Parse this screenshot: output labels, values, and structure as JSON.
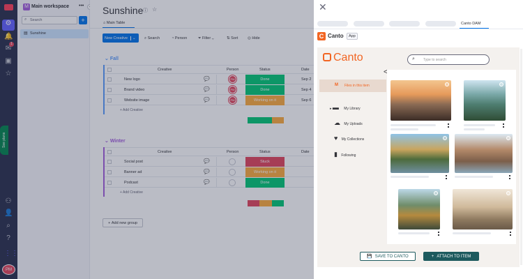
{
  "workspace": {
    "name": "Main workspace",
    "badge": "M",
    "search_placeholder": "Search",
    "boards": [
      "Sunshine"
    ]
  },
  "rail": {
    "notif_count": "1",
    "see_plans": "See plans",
    "avatar": "PM"
  },
  "board": {
    "title": "Sunshine",
    "view_tab": "Main Table",
    "toolbar": {
      "new": "New Creative",
      "search": "Search",
      "person": "Person",
      "filter": "Filter",
      "sort": "Sort",
      "hide": "Hide"
    },
    "columns": {
      "creative": "Creative",
      "person": "Person",
      "status": "Status",
      "date": "Date"
    },
    "groups": [
      {
        "name": "Fall",
        "color": "#579bfc",
        "rows": [
          {
            "name": "New logo",
            "person": "PM",
            "status": "Done",
            "status_color": "#00c875",
            "date": "Sep 2"
          },
          {
            "name": "Brand video",
            "person": "PM",
            "status": "Done",
            "status_color": "#00c875",
            "date": "Sep 4"
          },
          {
            "name": "Website image",
            "person": "PM",
            "status": "Working on it",
            "status_color": "#fdab3d",
            "date": "Sep 6"
          }
        ],
        "add": "+ Add Creative"
      },
      {
        "name": "Winter",
        "color": "#a25ddc",
        "rows": [
          {
            "name": "Social post",
            "person": "",
            "status": "Stuck",
            "status_color": "#e2445c",
            "date": ""
          },
          {
            "name": "Banner ad",
            "person": "",
            "status": "Working on it",
            "status_color": "#fdab3d",
            "date": ""
          },
          {
            "name": "Podcast",
            "person": "",
            "status": "Done",
            "status_color": "#00c875",
            "date": ""
          }
        ],
        "add": "+ Add Creative"
      }
    ],
    "add_group": "Add new group"
  },
  "panel": {
    "active_tab": "Canto DAM",
    "app_name": "Canto",
    "app_badge": "App",
    "brand": "Canto",
    "search_placeholder": "Type to search",
    "nav": [
      "Files in this item",
      "My Library",
      "My Uploads",
      "My Collections",
      "Following"
    ],
    "save_btn": "SAVE TO CANTO",
    "attach_btn": "ATTACH TO ITEM",
    "accent": "#f26522",
    "teal": "#1d5a5e"
  }
}
